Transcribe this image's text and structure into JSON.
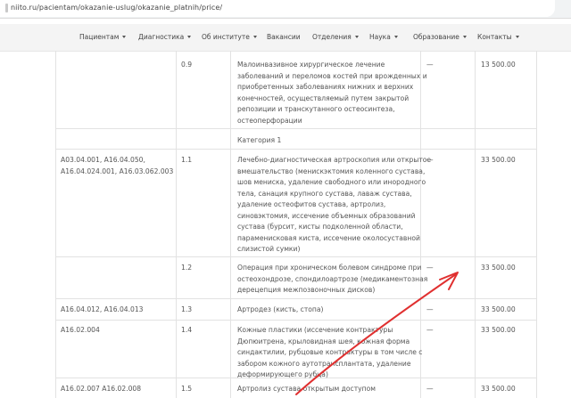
{
  "browser": {
    "url": "niito.ru/pacientam/okazanie-uslug/okazanie_platnih/price/"
  },
  "nav": {
    "items": [
      {
        "label": "Пациентам",
        "caret": true
      },
      {
        "label": "Диагностика",
        "caret": true
      },
      {
        "label": "Об институте",
        "caret": true
      },
      {
        "label": "Вакансии",
        "caret": false
      },
      {
        "label": "Отделения",
        "caret": true
      },
      {
        "label": "Наука",
        "caret": true
      },
      {
        "label": "Образование",
        "caret": true
      },
      {
        "label": "Контакты",
        "caret": true
      }
    ]
  },
  "table": {
    "rows": [
      {
        "code": "",
        "num": "0.9",
        "name_lines": [
          "Малоинвазивное хирургическое лечение",
          "заболеваний и переломов костей при врожденных и",
          "приобретенных заболеваниях нижних и верхних",
          "конечностей, осуществляемый путем закрытой",
          "репозиции и транскутанного остеосинтеза,",
          "остеоперфорации"
        ],
        "dash": "—",
        "price": "13 500.00"
      },
      {
        "code": "",
        "num": "",
        "name_lines": [
          "Категория 1"
        ],
        "dash": "",
        "price": ""
      },
      {
        "code": "А03.04.001, А16.04.050,\nА16.04.024.001, А16.03.062.003",
        "num": "1.1",
        "name_lines": [
          "Лечебно-диагностическая артроскопия или открытое",
          "вмешательство (менискэктомия коленного сустава,",
          "шов мениска, удаление свободного или инородного",
          "тела, санация крупного сустава, лаваж сустава,",
          "удаление остеофитов сустава, артролиз,",
          "синовэктомия, иссечение объемных образований",
          "сустава (бурсит, кисты подколенной области,",
          "параменисковая киста, иссечение околосуставной",
          "слизистой сумки)"
        ],
        "dash": "—",
        "price": "33 500.00"
      },
      {
        "code": "",
        "num": "1.2",
        "name_lines": [
          "Операция при хроническом болевом синдроме при",
          "остеохондрозе, спондилоартрозе (медикаментозная",
          "дерецепция межпозвоночных дисков)"
        ],
        "dash": "—",
        "price": "33 500.00"
      },
      {
        "code": "А16.04.012, А16.04.013",
        "num": "1.3",
        "name_lines": [
          "Артродез (кисть, стопа)"
        ],
        "dash": "—",
        "price": "33 500.00"
      },
      {
        "code": "А16.02.004",
        "num": "1.4",
        "name_lines": [
          "Кожные пластики (иссечение контрактуры",
          "Дюпюитрена, крыловидная шея, кожная форма",
          "синдактилии, рубцовые контрактуры в том числе с",
          "забором кожного аутотрансплантата, удаление",
          "деформирующего рубца)"
        ],
        "dash": "—",
        "price": "33 500.00"
      },
      {
        "code": "А16.02.007 А16.02.008",
        "num": "1.5",
        "name_lines": [
          "Артролиз сустава открытым доступом"
        ],
        "dash": "—",
        "price": "33 500.00"
      }
    ]
  },
  "annotation": {
    "color": "#e03030"
  }
}
